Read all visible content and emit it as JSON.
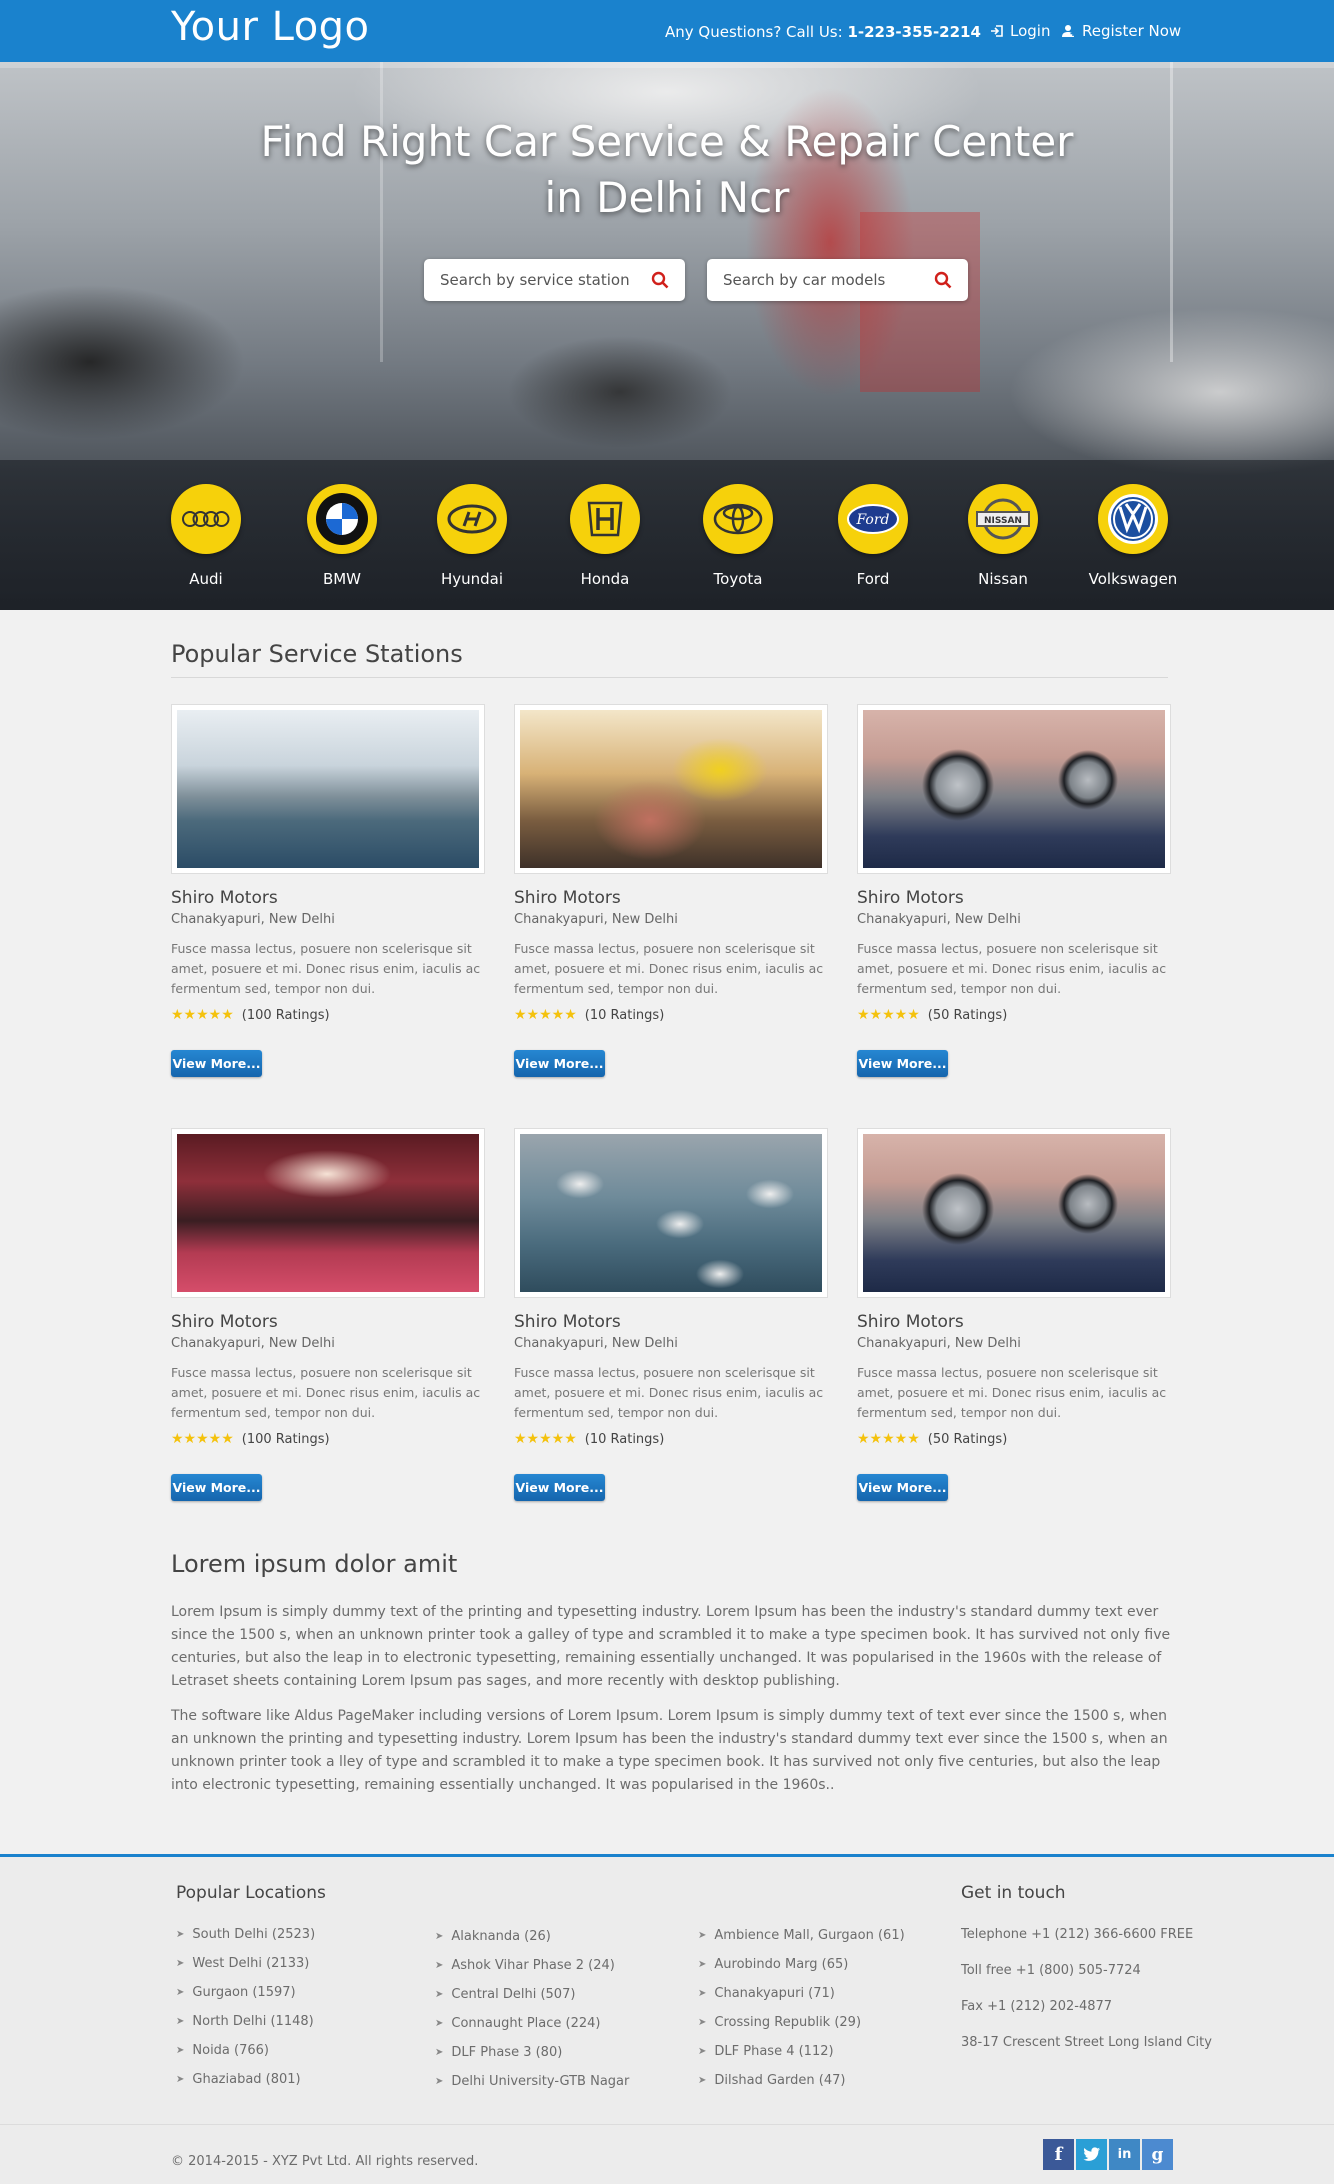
{
  "header": {
    "logo": "Your Logo",
    "call_prefix": "Any Questions? Call Us: ",
    "call_number": "1-223-355-2214",
    "login": "Login",
    "register": "Register Now"
  },
  "hero": {
    "title_line1": "Find Right Car Service & Repair Center",
    "title_line2": "in Delhi Ncr",
    "search_station_placeholder": "Search by service station",
    "search_model_placeholder": "Search by car models",
    "brands": [
      "Audi",
      "BMW",
      "Hyundai",
      "Honda",
      "Toyota",
      "Ford",
      "Nissan",
      "Volkswagen"
    ]
  },
  "popular": {
    "title": "Popular Service Stations",
    "cards": [
      {
        "name": "Shiro Motors",
        "location": "Chanakyapuri, New Delhi",
        "desc": "Fusce massa lectus, posuere non scelerisque sit amet, posuere et mi. Donec risus enim, iaculis ac fermentum sed, tempor non dui.",
        "stars": "★★★★★",
        "ratings": "(100 Ratings)",
        "button": "View More..."
      },
      {
        "name": "Shiro Motors",
        "location": "Chanakyapuri, New Delhi",
        "desc": "Fusce massa lectus, posuere non scelerisque sit amet, posuere et mi. Donec risus enim, iaculis ac fermentum sed, tempor non dui.",
        "stars": "★★★★★",
        "ratings": "(10 Ratings)",
        "button": "View More..."
      },
      {
        "name": "Shiro Motors",
        "location": "Chanakyapuri, New Delhi",
        "desc": "Fusce massa lectus, posuere non scelerisque sit amet, posuere et mi. Donec risus enim, iaculis ac fermentum sed, tempor non dui.",
        "stars": "★★★★★",
        "ratings": "(50 Ratings)",
        "button": "View More..."
      },
      {
        "name": "Shiro Motors",
        "location": "Chanakyapuri, New Delhi",
        "desc": "Fusce massa lectus, posuere non scelerisque sit amet, posuere et mi. Donec risus enim, iaculis ac fermentum sed, tempor non dui.",
        "stars": "★★★★★",
        "ratings": "(100 Ratings)",
        "button": "View More..."
      },
      {
        "name": "Shiro Motors",
        "location": "Chanakyapuri, New Delhi",
        "desc": "Fusce massa lectus, posuere non scelerisque sit amet, posuere et mi. Donec risus enim, iaculis ac fermentum sed, tempor non dui.",
        "stars": "★★★★★",
        "ratings": "(10 Ratings)",
        "button": "View More..."
      },
      {
        "name": "Shiro Motors",
        "location": "Chanakyapuri, New Delhi",
        "desc": "Fusce massa lectus, posuere non scelerisque sit amet, posuere et mi. Donec risus enim, iaculis ac fermentum sed, tempor non dui.",
        "stars": "★★★★★",
        "ratings": "(50 Ratings)",
        "button": "View More..."
      }
    ]
  },
  "about": {
    "title": "Lorem ipsum dolor amit",
    "p1": "Lorem Ipsum is simply dummy text of the printing and typesetting industry. Lorem Ipsum has been the industry's standard dummy text ever since the 1500 s, when an unknown printer took a galley of type and scrambled it to make a type specimen book. It has survived not only five centuries, but also the leap in to electronic typesetting, remaining essentially unchanged. It was popularised in the 1960s with the release of Letraset sheets containing Lorem Ipsum pas sages, and more recently with desktop publishing.",
    "p2": "The software like Aldus PageMaker including versions of Lorem Ipsum. Lorem Ipsum is simply dummy text of text ever since the 1500 s, when an unknown the printing and typesetting industry. Lorem Ipsum has been the industry's standard dummy text ever since the 1500 s, when an unknown printer took a lley of type and scrambled it to make a type specimen book. It has survived not only five centuries, but also the leap into electronic typesetting, remaining essentially unchanged. It was popularised in the 1960s.."
  },
  "footer": {
    "locations_title": "Popular Locations",
    "col1": [
      "South Delhi (2523)",
      "West Delhi (2133)",
      "Gurgaon (1597)",
      "North Delhi (1148)",
      "Noida (766)",
      "Ghaziabad (801)"
    ],
    "col2": [
      "Alaknanda (26)",
      "Ashok Vihar Phase 2 (24)",
      "Central Delhi (507)",
      "Connaught Place (224)",
      "DLF Phase 3 (80)",
      "Delhi University-GTB Nagar"
    ],
    "col3": [
      "Ambience Mall, Gurgaon (61)",
      "Aurobindo Marg (65)",
      "Chanakyapuri (71)",
      "Crossing Republik (29)",
      "DLF Phase 4 (112)",
      "Dilshad Garden (47)"
    ],
    "contact_title": "Get in touch",
    "contact": [
      "Telephone +1 (212) 366-6600 FREE",
      "Toll free +1 (800) 505-7724",
      "Fax +1 (212) 202-4877",
      "38-17 Crescent Street Long Island City"
    ],
    "copyright": "© 2014-2015 - XYZ Pvt Ltd. All rights reserved.",
    "social": {
      "facebook": "f",
      "linkedin": "in",
      "google": "g"
    }
  },
  "colors": {
    "header": "#1a82cd",
    "brand_circle": "#f6d10b",
    "button": "#1a74c0",
    "star": "#f4c20d",
    "facebook": "#3b5998",
    "twitter": "#2a9fd6",
    "linkedin": "#3f88c5",
    "google": "#4c8ad0"
  }
}
